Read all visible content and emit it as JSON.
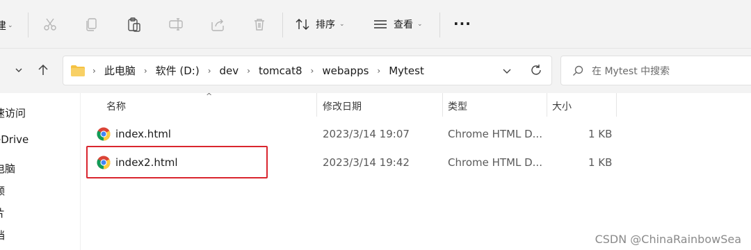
{
  "toolbar": {
    "cutoff_label": "建",
    "sort_label": "排序",
    "view_label": "查看",
    "more_label": "···"
  },
  "address_bar": {
    "breadcrumbs": [
      "此电脑",
      "软件 (D:)",
      "dev",
      "tomcat8",
      "webapps",
      "Mytest"
    ]
  },
  "search": {
    "placeholder": "在 Mytest 中搜索"
  },
  "nav_pane": {
    "items": [
      "速访问",
      "eDrive",
      "电脑",
      "频",
      "片",
      "档"
    ]
  },
  "file_list": {
    "columns": [
      "名称",
      "修改日期",
      "类型",
      "大小"
    ],
    "rows": [
      {
        "name": "index.html",
        "modified": "2023/3/14 19:07",
        "type": "Chrome HTML D...",
        "size": "1 KB"
      },
      {
        "name": "index2.html",
        "modified": "2023/3/14 19:42",
        "type": "Chrome HTML D...",
        "size": "1 KB"
      }
    ]
  },
  "watermark": "CSDN @ChinaRainbowSea",
  "colors": {
    "highlight": "#d9252e",
    "toolbar_bg": "#f3f3f3",
    "folder": "#f5c242"
  }
}
